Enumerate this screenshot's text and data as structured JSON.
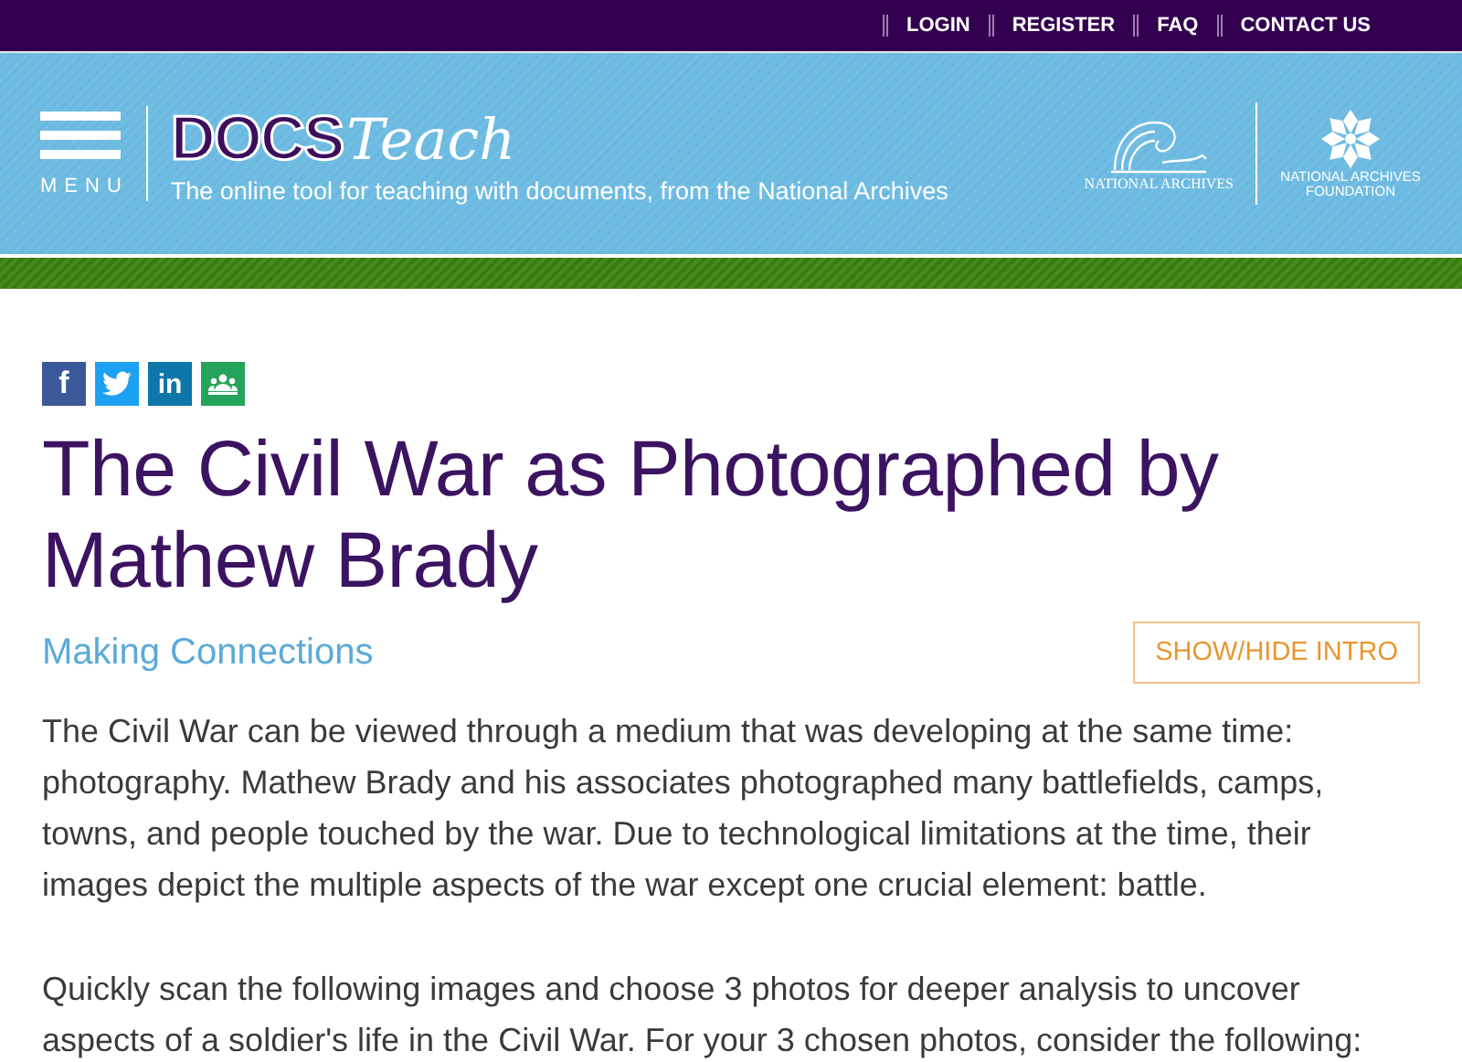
{
  "top_nav": [
    {
      "label": "LOGIN"
    },
    {
      "label": "REGISTER"
    },
    {
      "label": "FAQ"
    },
    {
      "label": "CONTACT US"
    }
  ],
  "header": {
    "menu_label": "MENU",
    "logo_bold": "DOCS",
    "logo_script": "Teach",
    "tagline": "The online tool for teaching with documents, from the National Archives",
    "partner_1": "NATIONAL ARCHIVES",
    "partner_2": "NATIONAL ARCHIVES FOUNDATION"
  },
  "share": [
    {
      "kind": "facebook",
      "glyph": "f"
    },
    {
      "kind": "twitter"
    },
    {
      "kind": "linkedin",
      "glyph": "in"
    },
    {
      "kind": "classroom"
    }
  ],
  "title": "The Civil War as Photographed by Mathew Brady",
  "subtitle": "Making Connections",
  "intro_button": "SHOW/HIDE INTRO",
  "paragraphs": [
    "The Civil War can be viewed through a medium that was developing at the same time: photography. Mathew Brady and his associates photographed many battlefields, camps, towns, and people touched by the war. Due to technological limitations at the time, their images depict the multiple aspects of the war except one crucial element: battle.",
    "Quickly scan the following images and choose 3 photos for deeper analysis to uncover aspects of a soldier's life in the Civil War.  For your 3 chosen photos, consider the following:"
  ]
}
